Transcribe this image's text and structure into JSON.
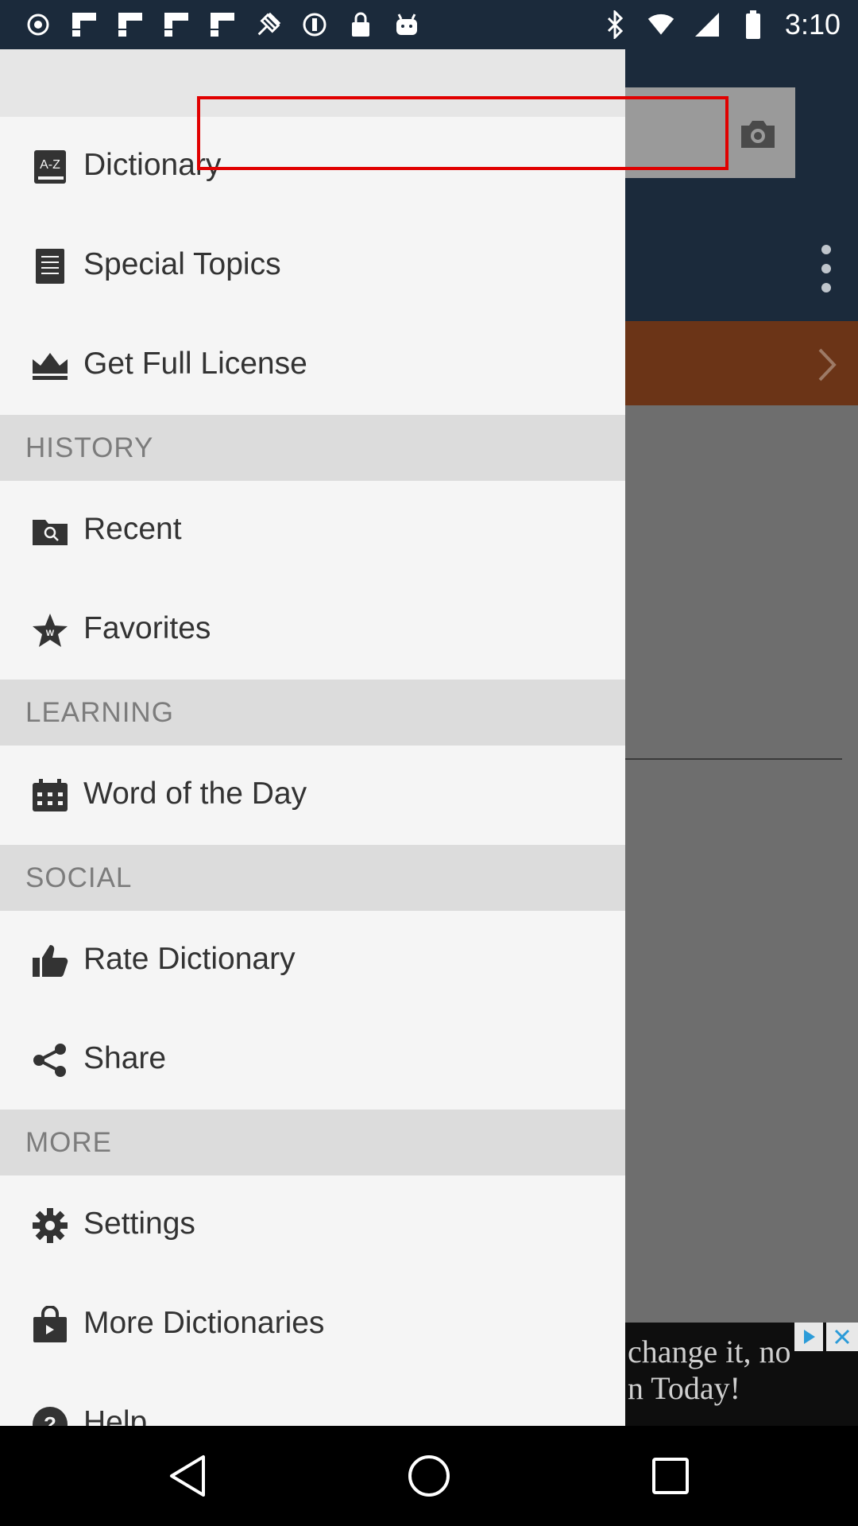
{
  "status_bar": {
    "time": "3:10",
    "left_icons": [
      "record-icon",
      "flipboard-icon",
      "flipboard-icon",
      "flipboard-icon",
      "flipboard-icon",
      "fake-gps-icon",
      "sync-icon",
      "lock-icon",
      "android-icon"
    ],
    "right_icons": [
      "bluetooth-icon",
      "wifi-icon",
      "signal-icon",
      "battery-icon"
    ]
  },
  "drawer": {
    "items": [
      {
        "label": "Dictionary",
        "icon": "a-z-dictionary-icon"
      },
      {
        "label": "Special Topics",
        "icon": "document-icon"
      },
      {
        "label": "Get Full License",
        "icon": "crown-icon"
      }
    ],
    "sections": [
      {
        "title": "HISTORY",
        "items": [
          {
            "label": "Recent",
            "icon": "folder-search-icon"
          },
          {
            "label": "Favorites",
            "icon": "star-icon"
          }
        ]
      },
      {
        "title": "LEARNING",
        "items": [
          {
            "label": "Word of the Day",
            "icon": "calendar-icon"
          }
        ]
      },
      {
        "title": "SOCIAL",
        "items": [
          {
            "label": "Rate Dictionary",
            "icon": "thumbs-up-icon"
          },
          {
            "label": "Share",
            "icon": "share-icon"
          }
        ]
      },
      {
        "title": "MORE",
        "items": [
          {
            "label": "Settings",
            "icon": "gear-icon"
          },
          {
            "label": "More Dictionaries",
            "icon": "shopping-bag-icon"
          },
          {
            "label": "Help",
            "icon": "help-icon"
          }
        ]
      }
    ]
  },
  "ad": {
    "line1": "change it, no",
    "line2": "n Today!"
  },
  "colors": {
    "toolbar": "#1b2a3b",
    "promo": "#6b3417",
    "drawer_bg": "#f5f5f5",
    "section_bg": "#dcdcdc",
    "highlight": "#e10000"
  }
}
